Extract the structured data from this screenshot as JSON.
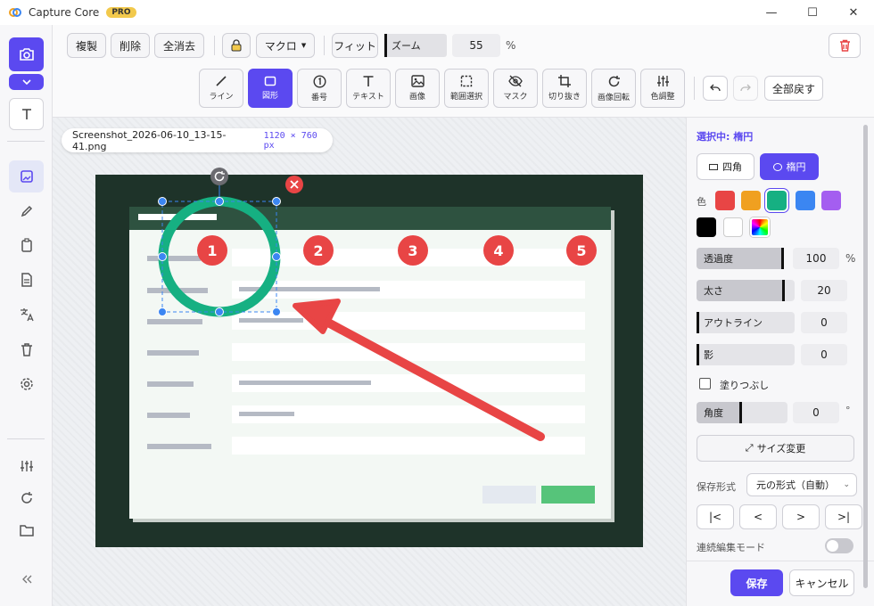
{
  "app": {
    "title": "Capture Core",
    "badge": "PRO"
  },
  "window_controls": {
    "minimize": "—",
    "maximize": "☐",
    "close": "✕"
  },
  "toolbar": {
    "duplicate": "複製",
    "delete": "削除",
    "clear_all": "全消去",
    "macro": "マクロ",
    "fit": "フィット",
    "zoom_label": "ズーム",
    "zoom_value": "55",
    "zoom_unit": "%",
    "reset_all": "全部戻す"
  },
  "tools": [
    {
      "label": "ライン",
      "icon": "line-icon"
    },
    {
      "label": "図形",
      "icon": "shape-icon"
    },
    {
      "label": "番号",
      "icon": "number-icon"
    },
    {
      "label": "テキスト",
      "icon": "text-icon"
    },
    {
      "label": "画像",
      "icon": "image-icon"
    },
    {
      "label": "範囲選択",
      "icon": "selection-icon"
    },
    {
      "label": "マスク",
      "icon": "mask-icon"
    },
    {
      "label": "切り抜き",
      "icon": "crop-icon"
    },
    {
      "label": "画像回転",
      "icon": "rotate-icon"
    },
    {
      "label": "色調整",
      "icon": "adjust-icon"
    }
  ],
  "file": {
    "name": "Screenshot_2026-06-10_13-15-41.png",
    "dims": "1120 × 760 px"
  },
  "canvas": {
    "markers": [
      "1",
      "2",
      "3",
      "4",
      "5"
    ]
  },
  "panel": {
    "selected": "選択中: 楕円",
    "shape_rect": "四角",
    "shape_ellipse": "楕円",
    "color_label": "色",
    "opacity_label": "透過度",
    "opacity_value": "100",
    "opacity_unit": "%",
    "thickness_label": "太さ",
    "thickness_value": "20",
    "outline_label": "アウトライン",
    "outline_value": "0",
    "shadow_label": "影",
    "shadow_value": "0",
    "fill_label": "塗りつぶし",
    "angle_label": "角度",
    "angle_value": "0",
    "angle_unit": "°",
    "resize": "サイズ変更",
    "save_format_label": "保存形式",
    "save_format_value": "元の形式（自動）",
    "continuous_mode": "連続編集モード",
    "save": "保存",
    "cancel": "キャンセル"
  },
  "levels": {
    "opacity": 1.0,
    "thickness": 0.9,
    "outline": 0,
    "shadow": 0,
    "angle": 0.5
  },
  "colors": {
    "accent": "#5b49f0",
    "swatches": [
      "#e84545",
      "#f0a020",
      "#16b082",
      "#3b86f2",
      "#a45ef0",
      "#000000",
      "#ffffff",
      "rainbow"
    ],
    "selected_swatch": "#16b082"
  }
}
